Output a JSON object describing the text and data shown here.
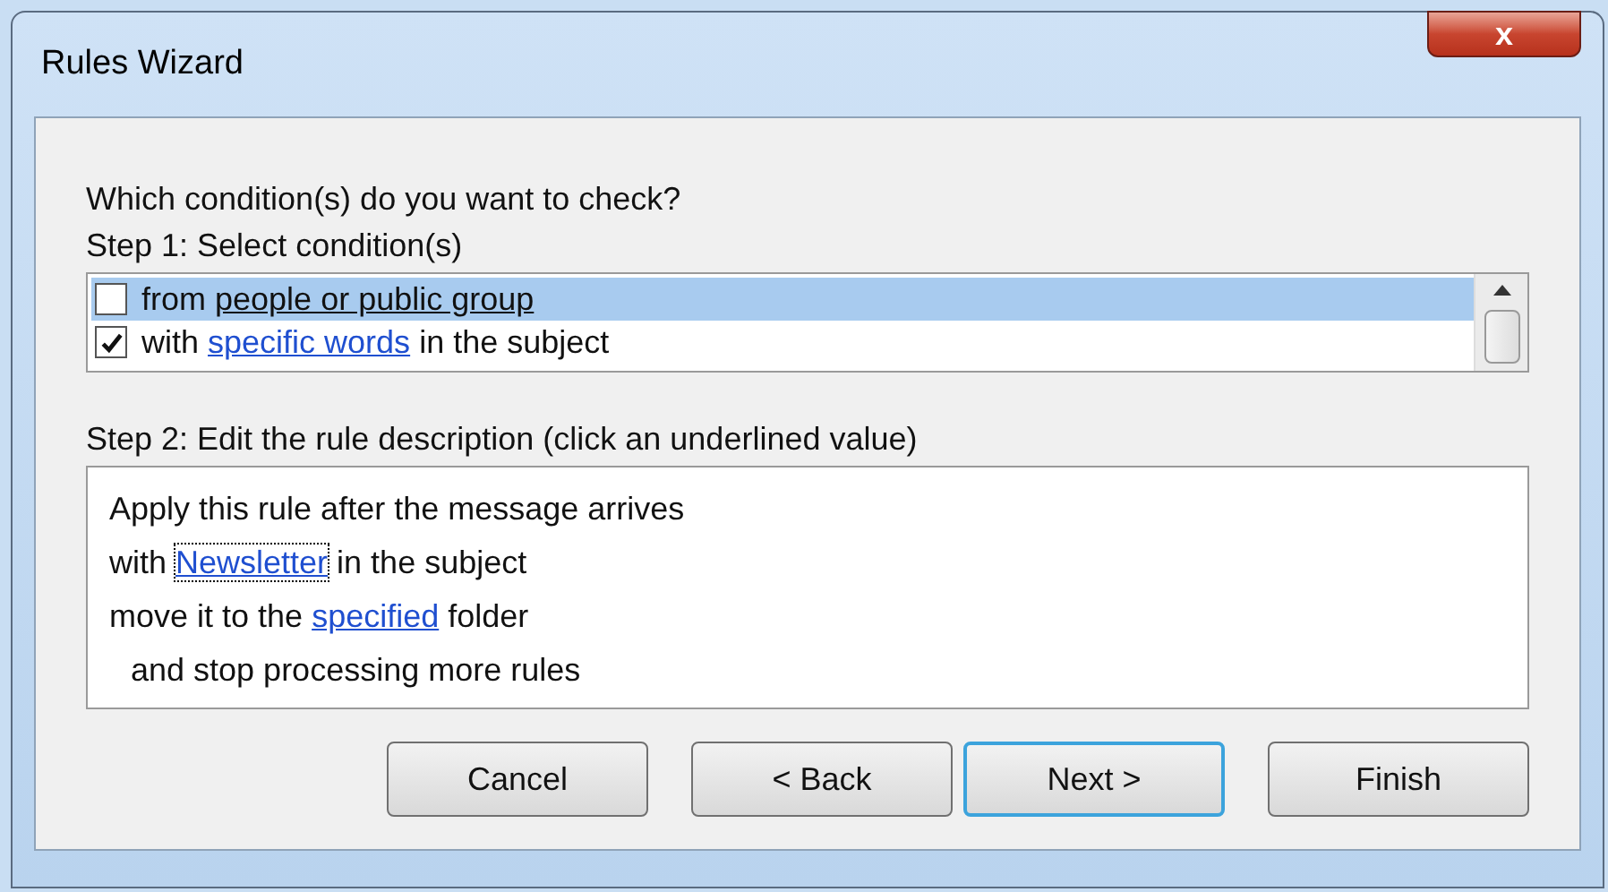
{
  "window": {
    "title": "Rules Wizard",
    "close_label": "x"
  },
  "question": "Which condition(s) do you want to check?",
  "step1": "Step 1: Select condition(s)",
  "conditions": [
    {
      "checked": false,
      "selected": true,
      "parts": [
        {
          "kind": "plain",
          "text": "from "
        },
        {
          "kind": "link",
          "text": "people or public group"
        }
      ]
    },
    {
      "checked": true,
      "selected": false,
      "parts": [
        {
          "kind": "plain",
          "text": "with "
        },
        {
          "kind": "link",
          "text": "specific words"
        },
        {
          "kind": "plain",
          "text": " in the subject"
        }
      ]
    }
  ],
  "step2": "Step 2: Edit the rule description (click an underlined value)",
  "description": [
    {
      "parts": [
        {
          "kind": "plain",
          "text": "Apply this rule after the message arrives"
        }
      ]
    },
    {
      "parts": [
        {
          "kind": "plain",
          "text": "with "
        },
        {
          "kind": "link",
          "text": "Newsletter",
          "focused": true
        },
        {
          "kind": "plain",
          "text": " in the subject"
        }
      ]
    },
    {
      "parts": [
        {
          "kind": "plain",
          "text": "move it to the "
        },
        {
          "kind": "link",
          "text": "specified",
          "focused": false
        },
        {
          "kind": "plain",
          "text": " folder"
        }
      ],
      "children": [
        {
          "parts": [
            {
              "kind": "plain",
              "text": "and stop processing more rules"
            }
          ]
        }
      ]
    }
  ],
  "buttons": [
    {
      "label": "Cancel",
      "default": false
    },
    {
      "label": "< Back",
      "default": false
    },
    {
      "label": "Next >",
      "default": true
    },
    {
      "label": "Finish",
      "default": false
    }
  ]
}
